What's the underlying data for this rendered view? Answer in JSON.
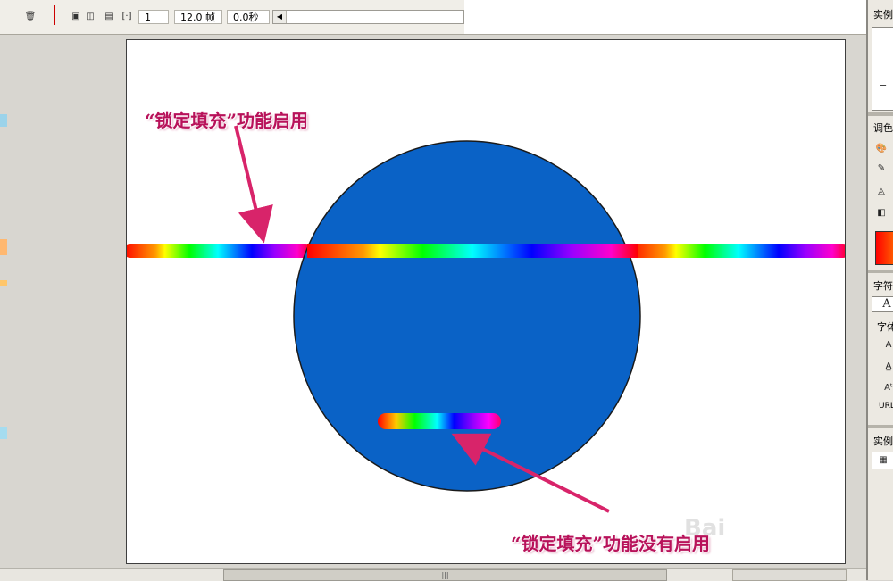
{
  "toolbar": {
    "frame": "1",
    "fps": "12.0 帧",
    "time": "0.0秒",
    "trash_icon": "trash-icon",
    "icons": [
      "onion-skin-icon",
      "onion-skin-outline-icon",
      "edit-multiple-frames-icon",
      "modify-markers-icon"
    ]
  },
  "annotations": {
    "top": "“锁定填充”功能启用",
    "bottom": "“锁定填充”功能没有启用"
  },
  "watermark": "Bai",
  "right_panel": {
    "instance_top": "实例",
    "color_panel": "调色",
    "char_panel": "字符",
    "char_label": "字体",
    "char_a": "A",
    "url_label": "URL",
    "instance_bottom": "实例"
  },
  "colors": {
    "circle_fill": "#0a62c6",
    "circle_stroke": "#1a1a1a",
    "annotation": "#b8125a",
    "arrow": "#d8246a",
    "rainbow": [
      "#ff0000",
      "#ff8000",
      "#ffff00",
      "#00ff00",
      "#00ffff",
      "#0000ff",
      "#8000ff",
      "#ff00ff",
      "#ff0000"
    ]
  }
}
